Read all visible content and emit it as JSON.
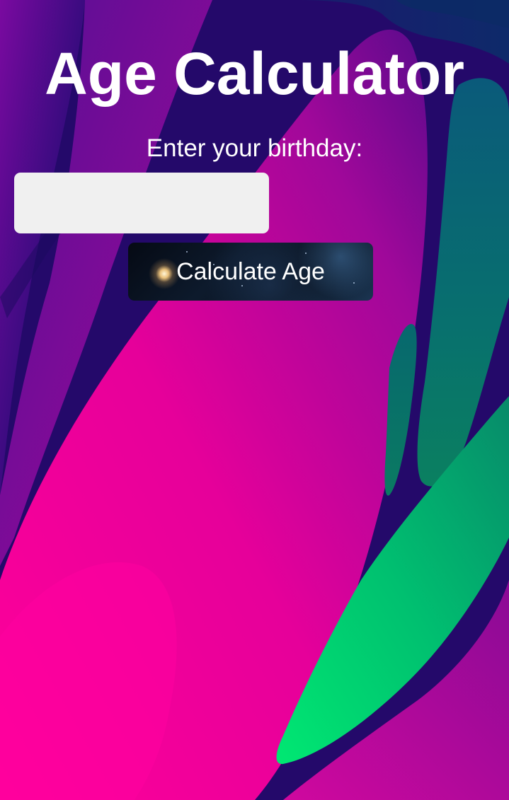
{
  "app": {
    "title": "Age Calculator"
  },
  "form": {
    "birthday_label": "Enter your birthday:",
    "birthday_value": "",
    "birthday_placeholder": "",
    "calculate_label": "Calculate Age"
  },
  "colors": {
    "text": "#ffffff",
    "input_bg": "#f0f0f0",
    "bg_magenta": "#ff0099",
    "bg_indigo": "#2a0a6e",
    "bg_teal": "#0a5a78",
    "bg_green": "#00e070"
  }
}
